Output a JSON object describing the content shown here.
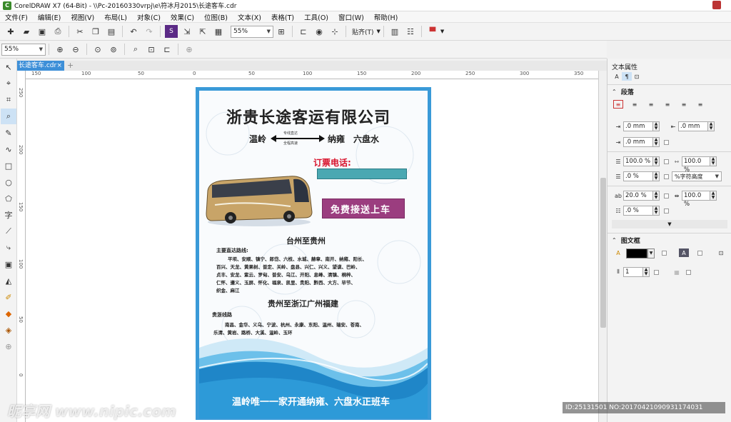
{
  "window": {
    "title": "CorelDRAW X7 (64-Bit) - \\\\Pc-20160330vrpj\\e\\符冰月2015\\长途客车.cdr"
  },
  "menu": [
    "文件(F)",
    "编辑(E)",
    "视图(V)",
    "布局(L)",
    "对象(C)",
    "效果(C)",
    "位图(B)",
    "文本(X)",
    "表格(T)",
    "工具(O)",
    "窗口(W)",
    "帮助(H)"
  ],
  "toolbar": {
    "zoom": "55%",
    "snap": "贴齐(T)"
  },
  "propbar": {
    "zoom": "55%"
  },
  "doc_tab": {
    "label": "长途客车.cdr"
  },
  "ruler": {
    "h_labels": [
      "150",
      "100",
      "50",
      "0",
      "50",
      "100",
      "150",
      "200",
      "250",
      "300",
      "350"
    ],
    "v_labels": [
      "250",
      "200",
      "150",
      "100",
      "50",
      "0"
    ]
  },
  "docker": {
    "title": "文本属性",
    "paragraph": {
      "header": "段落",
      "left_indent": ".0 mm",
      "right_indent": ".0 mm",
      "first_indent": ".0 mm",
      "line_spacing": "100.0 %",
      "char_spacing": "100.0 %",
      "before_para": ".0 %",
      "spacing_unit": "%字符高度",
      "lang_spacing": "20.0 %",
      "word_spacing": "100.0 %",
      "after_para": ".0 %"
    },
    "frame": {
      "header": "图文框",
      "columns": "1"
    }
  },
  "poster": {
    "company": "浙贵长途客运有限公司",
    "from": "温岭",
    "arrow_top": "专线直达",
    "arrow_bottom": "全程高速",
    "to": "纳雍　六盘水",
    "phone_label": "订票电话:",
    "pickup": "免费接送上车",
    "route1_title": "台州至贵州",
    "route1_sub": "主要直达路线:",
    "route1_lines": [
      "平坝、安顺、镇宁、郎岱、六枝、水城、赫章、南开、纳雍、阳长、",
      "百兴、天龙、黄果树、普定、关岭、盘县、兴仁、兴义、望谟、巴岭、",
      "贞丰、安龙、紫云、罗甸、普安、乌江、开阳、息峰、清镇、桐梓、",
      "仁怀、遵义、玉屏、怀化、福泉、凯里、贵阳、黔西、大方、毕节、",
      "织金、麻江"
    ],
    "route2_title": "贵州至浙江广州福建",
    "route2_sub": "贵浙线路",
    "route2_lines": [
      "南昌、金华、义乌、宁波、杭州、永康、东阳、温州、瑞安、苍南、",
      "乐清、黄岩、路桥、大溪、温岭、玉环"
    ],
    "slogan": "温岭唯一一家开通纳雍、六盘水正班车"
  },
  "overlay": {
    "watermark": "昵享网 www.nipic.com",
    "id": "ID:25131501 NO:20170421090931174031"
  },
  "colors": {
    "accent": "#3d8fd8",
    "pickup_bg": "#9b3d7f",
    "phone_red": "#d8102a",
    "phone_box": "#4aa8b2"
  }
}
